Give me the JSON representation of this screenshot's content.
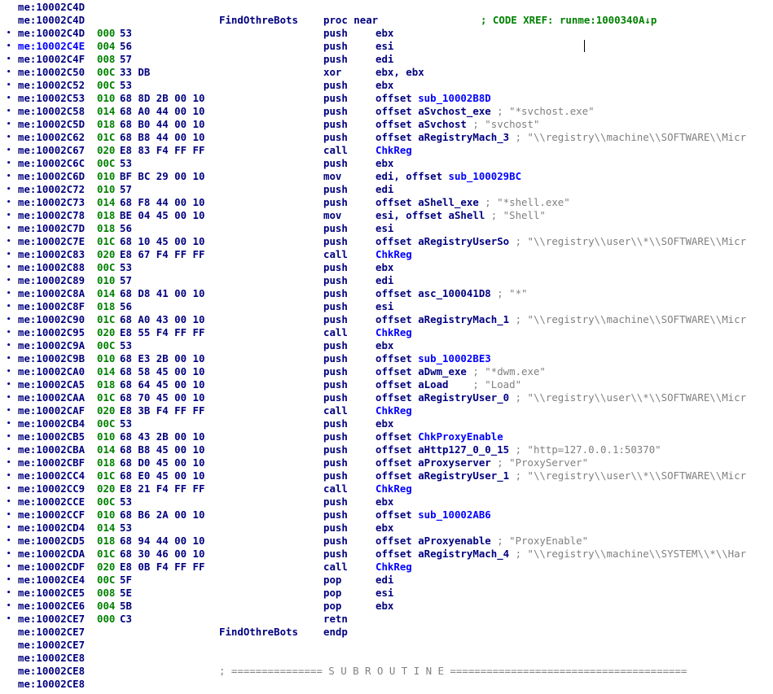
{
  "view": {
    "name": "IDA View",
    "lines": [
      {
        "addr": "me:10002C4D"
      },
      {
        "addr": "me:10002C4D",
        "label": "FindOthreBots",
        "mnem": "proc near",
        "xref": "; CODE XREF: runme:1000340A↓p"
      },
      {
        "dot": true,
        "addr": "me:10002C4D",
        "sp": "000",
        "bytes": "53",
        "mnem": "push",
        "ops": "ebx"
      },
      {
        "dot": true,
        "addr": "me:10002C4E",
        "addr_style": "xref",
        "sp": "004",
        "bytes": "56",
        "mnem": "push",
        "ops": "esi"
      },
      {
        "dot": true,
        "addr": "me:10002C4F",
        "sp": "008",
        "bytes": "57",
        "mnem": "push",
        "ops": "edi"
      },
      {
        "dot": true,
        "addr": "me:10002C50",
        "sp": "00C",
        "bytes": "33 DB",
        "mnem": "xor",
        "ops": "ebx, ebx"
      },
      {
        "dot": true,
        "addr": "me:10002C52",
        "sp": "00C",
        "bytes": "53",
        "mnem": "push",
        "ops": "ebx"
      },
      {
        "dot": true,
        "addr": "me:10002C53",
        "sp": "010",
        "bytes": "68 8D 2B 00 10",
        "mnem": "push",
        "ops": "offset ",
        "sym": "sub_10002B8D"
      },
      {
        "dot": true,
        "addr": "me:10002C58",
        "sp": "014",
        "bytes": "68 A0 44 00 10",
        "mnem": "push",
        "ops": "offset aSvchost_exe",
        "cmt": " ; \"*svchost.exe\""
      },
      {
        "dot": true,
        "addr": "me:10002C5D",
        "sp": "018",
        "bytes": "68 B0 44 00 10",
        "mnem": "push",
        "ops": "offset aSvchost",
        "cmt": " ; \"svchost\""
      },
      {
        "dot": true,
        "addr": "me:10002C62",
        "sp": "01C",
        "bytes": "68 B8 44 00 10",
        "mnem": "push",
        "ops": "offset aRegistryMach_3",
        "cmt": " ; \"\\\\registry\\\\machine\\\\SOFTWARE\\\\Micr"
      },
      {
        "dot": true,
        "addr": "me:10002C67",
        "sp": "020",
        "bytes": "E8 83 F4 FF FF",
        "mnem": "call",
        "ops": "",
        "sym": "ChkReg"
      },
      {
        "dot": true,
        "addr": "me:10002C6C",
        "sp": "00C",
        "bytes": "53",
        "mnem": "push",
        "ops": "ebx"
      },
      {
        "dot": true,
        "addr": "me:10002C6D",
        "sp": "010",
        "bytes": "BF BC 29 00 10",
        "mnem": "mov",
        "ops": "edi, offset ",
        "sym": "sub_100029BC"
      },
      {
        "dot": true,
        "addr": "me:10002C72",
        "sp": "010",
        "bytes": "57",
        "mnem": "push",
        "ops": "edi"
      },
      {
        "dot": true,
        "addr": "me:10002C73",
        "sp": "014",
        "bytes": "68 F8 44 00 10",
        "mnem": "push",
        "ops": "offset aShell_exe",
        "cmt": " ; \"*shell.exe\""
      },
      {
        "dot": true,
        "addr": "me:10002C78",
        "sp": "018",
        "bytes": "BE 04 45 00 10",
        "mnem": "mov",
        "ops": "esi, offset aShell",
        "cmt": " ; \"Shell\""
      },
      {
        "dot": true,
        "addr": "me:10002C7D",
        "sp": "018",
        "bytes": "56",
        "mnem": "push",
        "ops": "esi"
      },
      {
        "dot": true,
        "addr": "me:10002C7E",
        "sp": "01C",
        "bytes": "68 10 45 00 10",
        "mnem": "push",
        "ops": "offset aRegistryUserSo",
        "cmt": " ; \"\\\\registry\\\\user\\\\*\\\\SOFTWARE\\\\Micr"
      },
      {
        "dot": true,
        "addr": "me:10002C83",
        "sp": "020",
        "bytes": "E8 67 F4 FF FF",
        "mnem": "call",
        "ops": "",
        "sym": "ChkReg"
      },
      {
        "dot": true,
        "addr": "me:10002C88",
        "sp": "00C",
        "bytes": "53",
        "mnem": "push",
        "ops": "ebx"
      },
      {
        "dot": true,
        "addr": "me:10002C89",
        "sp": "010",
        "bytes": "57",
        "mnem": "push",
        "ops": "edi"
      },
      {
        "dot": true,
        "addr": "me:10002C8A",
        "sp": "014",
        "bytes": "68 D8 41 00 10",
        "mnem": "push",
        "ops": "offset asc_100041D8",
        "cmt": " ; \"*\""
      },
      {
        "dot": true,
        "addr": "me:10002C8F",
        "sp": "018",
        "bytes": "56",
        "mnem": "push",
        "ops": "esi"
      },
      {
        "dot": true,
        "addr": "me:10002C90",
        "sp": "01C",
        "bytes": "68 A0 43 00 10",
        "mnem": "push",
        "ops": "offset aRegistryMach_1",
        "cmt": " ; \"\\\\registry\\\\machine\\\\SOFTWARE\\\\Micr"
      },
      {
        "dot": true,
        "addr": "me:10002C95",
        "sp": "020",
        "bytes": "E8 55 F4 FF FF",
        "mnem": "call",
        "ops": "",
        "sym": "ChkReg"
      },
      {
        "dot": true,
        "addr": "me:10002C9A",
        "sp": "00C",
        "bytes": "53",
        "mnem": "push",
        "ops": "ebx"
      },
      {
        "dot": true,
        "addr": "me:10002C9B",
        "sp": "010",
        "bytes": "68 E3 2B 00 10",
        "mnem": "push",
        "ops": "offset ",
        "sym": "sub_10002BE3"
      },
      {
        "dot": true,
        "addr": "me:10002CA0",
        "sp": "014",
        "bytes": "68 58 45 00 10",
        "mnem": "push",
        "ops": "offset aDwm_exe",
        "cmt": " ; \"*dwm.exe\""
      },
      {
        "dot": true,
        "addr": "me:10002CA5",
        "sp": "018",
        "bytes": "68 64 45 00 10",
        "mnem": "push",
        "ops": "offset aLoad   ",
        "cmt": " ; \"Load\""
      },
      {
        "dot": true,
        "addr": "me:10002CAA",
        "sp": "01C",
        "bytes": "68 70 45 00 10",
        "mnem": "push",
        "ops": "offset aRegistryUser_0",
        "cmt": " ; \"\\\\registry\\\\user\\\\*\\\\SOFTWARE\\\\Micr"
      },
      {
        "dot": true,
        "addr": "me:10002CAF",
        "sp": "020",
        "bytes": "E8 3B F4 FF FF",
        "mnem": "call",
        "ops": "",
        "sym": "ChkReg"
      },
      {
        "dot": true,
        "addr": "me:10002CB4",
        "sp": "00C",
        "bytes": "53",
        "mnem": "push",
        "ops": "ebx"
      },
      {
        "dot": true,
        "addr": "me:10002CB5",
        "sp": "010",
        "bytes": "68 43 2B 00 10",
        "mnem": "push",
        "ops": "offset ",
        "sym": "ChkProxyEnable"
      },
      {
        "dot": true,
        "addr": "me:10002CBA",
        "sp": "014",
        "bytes": "68 B8 45 00 10",
        "mnem": "push",
        "ops": "offset aHttp127_0_0_15",
        "cmt": " ; \"http=127.0.0.1:50370\""
      },
      {
        "dot": true,
        "addr": "me:10002CBF",
        "sp": "018",
        "bytes": "68 D0 45 00 10",
        "mnem": "push",
        "ops": "offset aProxyserver",
        "cmt": " ; \"ProxyServer\""
      },
      {
        "dot": true,
        "addr": "me:10002CC4",
        "sp": "01C",
        "bytes": "68 E0 45 00 10",
        "mnem": "push",
        "ops": "offset aRegistryUser_1",
        "cmt": " ; \"\\\\registry\\\\user\\\\*\\\\SOFTWARE\\\\Micr"
      },
      {
        "dot": true,
        "addr": "me:10002CC9",
        "sp": "020",
        "bytes": "E8 21 F4 FF FF",
        "mnem": "call",
        "ops": "",
        "sym": "ChkReg"
      },
      {
        "dot": true,
        "addr": "me:10002CCE",
        "sp": "00C",
        "bytes": "53",
        "mnem": "push",
        "ops": "ebx"
      },
      {
        "dot": true,
        "addr": "me:10002CCF",
        "sp": "010",
        "bytes": "68 B6 2A 00 10",
        "mnem": "push",
        "ops": "offset ",
        "sym": "sub_10002AB6"
      },
      {
        "dot": true,
        "addr": "me:10002CD4",
        "sp": "014",
        "bytes": "53",
        "mnem": "push",
        "ops": "ebx"
      },
      {
        "dot": true,
        "addr": "me:10002CD5",
        "sp": "018",
        "bytes": "68 94 44 00 10",
        "mnem": "push",
        "ops": "offset aProxyenable",
        "cmt": " ; \"ProxyEnable\""
      },
      {
        "dot": true,
        "addr": "me:10002CDA",
        "sp": "01C",
        "bytes": "68 30 46 00 10",
        "mnem": "push",
        "ops": "offset aRegistryMach_4",
        "cmt": " ; \"\\\\registry\\\\machine\\\\SYSTEM\\\\*\\\\Har"
      },
      {
        "dot": true,
        "addr": "me:10002CDF",
        "sp": "020",
        "bytes": "E8 0B F4 FF FF",
        "mnem": "call",
        "ops": "",
        "sym": "ChkReg"
      },
      {
        "dot": true,
        "addr": "me:10002CE4",
        "sp": "00C",
        "bytes": "5F",
        "mnem": "pop",
        "ops": "edi"
      },
      {
        "dot": true,
        "addr": "me:10002CE5",
        "sp": "008",
        "bytes": "5E",
        "mnem": "pop",
        "ops": "esi"
      },
      {
        "dot": true,
        "addr": "me:10002CE6",
        "sp": "004",
        "bytes": "5B",
        "mnem": "pop",
        "ops": "ebx"
      },
      {
        "dot": true,
        "addr": "me:10002CE7",
        "sp": "000",
        "bytes": "C3",
        "mnem": "retn",
        "ops": ""
      },
      {
        "addr": "me:10002CE7",
        "label": "FindOthreBots",
        "mnem": "endp"
      },
      {
        "addr": "me:10002CE7"
      },
      {
        "addr": "me:10002CE8"
      },
      {
        "addr": "me:10002CE8",
        "sub": "; =============== S U B R O U T I N E ======================================="
      },
      {
        "addr": "me:10002CE8"
      }
    ]
  }
}
